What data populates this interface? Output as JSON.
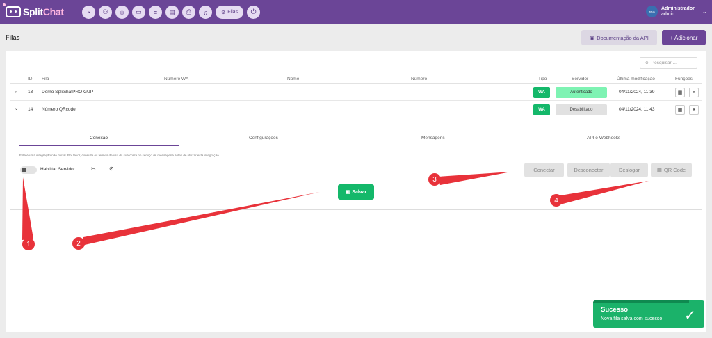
{
  "app": {
    "logo_split": "Split",
    "logo_chat": "Chat"
  },
  "nav": {
    "icons": [
      "dashboard-icon",
      "contacts-icon",
      "user-add-icon",
      "chat-icon",
      "list-icon",
      "document-icon",
      "printer-icon",
      "bell-icon"
    ],
    "active_label": "Filas"
  },
  "user": {
    "avatar_text": "zeus",
    "name": "Administrador",
    "role": "admin"
  },
  "page": {
    "title": "Filas",
    "doc_button": "Documentação da API",
    "add_button": "+ Adicionar"
  },
  "search": {
    "placeholder": "Pesquisar ..."
  },
  "table": {
    "headers": {
      "id": "ID",
      "fila": "Fila",
      "numero_wa": "Número WA",
      "nome": "Nome",
      "numero": "Número",
      "tipo": "Tipo",
      "servidor": "Servidor",
      "ultima": "Última modificação",
      "funcoes": "Funções"
    },
    "rows": [
      {
        "expander": "›",
        "id": "13",
        "fila": "Demo SplitchatPRO GUP",
        "tipo": "WA",
        "servidor": "Autenticado",
        "data": "04/11/2024, 11:39"
      },
      {
        "expander": "⌄",
        "id": "14",
        "fila": "Número QRcode",
        "tipo": "WA",
        "servidor": "Desabilitado",
        "data": "04/11/2024, 11:43"
      }
    ]
  },
  "detail": {
    "tabs": [
      "Conexão",
      "Configurações",
      "Mensagens",
      "API e Webhooks"
    ],
    "notice": "Esta é uma integração não oficial. Por favor, consulte os termos de uso da sua conta no serviço de mensageria antes de utilizar esta integração.",
    "toggle_label": "Habilitar Servidor",
    "actions": [
      "Conectar",
      "Desconectar",
      "Deslogar",
      "QR Code"
    ],
    "save": "Salvar"
  },
  "annotations": [
    "1",
    "2",
    "3",
    "4"
  ],
  "toast": {
    "title": "Sucesso",
    "message": "Nova fila salva com sucesso!"
  },
  "colors": {
    "brand": "#6b4597",
    "success": "#14b86a",
    "annotation": "#e8323a"
  }
}
